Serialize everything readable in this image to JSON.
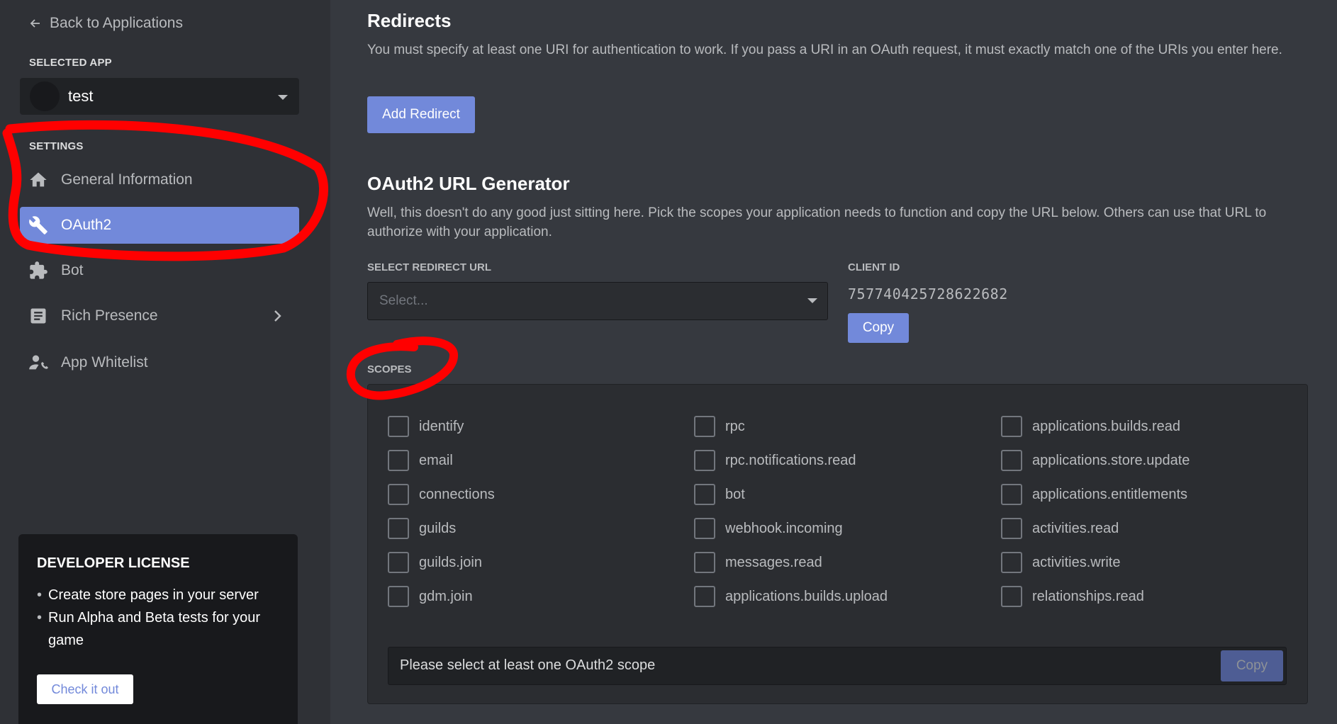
{
  "sidebar": {
    "back_label": "Back to Applications",
    "selected_app_label": "SELECTED APP",
    "app_name": "test",
    "settings_label": "SETTINGS",
    "items": [
      {
        "label": "General Information",
        "icon": "home-icon"
      },
      {
        "label": "OAuth2",
        "icon": "wrench-icon",
        "active": true
      },
      {
        "label": "Bot",
        "icon": "puzzle-icon"
      },
      {
        "label": "Rich Presence",
        "icon": "document-icon"
      },
      {
        "label": "App Whitelist",
        "icon": "user-phone-icon"
      }
    ],
    "developer_license": {
      "title": "DEVELOPER LICENSE",
      "bullets": [
        "Create store pages in your server",
        "Run Alpha and Beta tests for your game"
      ],
      "button": "Check it out"
    }
  },
  "redirects": {
    "title": "Redirects",
    "description": "You must specify at least one URI for authentication to work. If you pass a URI in an OAuth request, it must exactly match one of the URIs you enter here.",
    "add_button": "Add Redirect"
  },
  "generator": {
    "title": "OAuth2 URL Generator",
    "description": "Well, this doesn't do any good just sitting here. Pick the scopes your application needs to function and copy the URL below. Others can use that URL to authorize with your application.",
    "redirect_label": "SELECT REDIRECT URL",
    "redirect_placeholder": "Select...",
    "client_id_label": "CLIENT ID",
    "client_id": "757740425728622682",
    "copy_label": "Copy",
    "scopes_label": "SCOPES",
    "scopes": [
      [
        "identify",
        "email",
        "connections",
        "guilds",
        "guilds.join",
        "gdm.join"
      ],
      [
        "rpc",
        "rpc.notifications.read",
        "bot",
        "webhook.incoming",
        "messages.read",
        "applications.builds.upload"
      ],
      [
        "applications.builds.read",
        "applications.store.update",
        "applications.entitlements",
        "activities.read",
        "activities.write",
        "relationships.read"
      ]
    ],
    "url_placeholder": "Please select at least one OAuth2 scope",
    "url_copy_label": "Copy"
  },
  "colors": {
    "accent": "#7289da",
    "annotation": "#ff0000"
  }
}
